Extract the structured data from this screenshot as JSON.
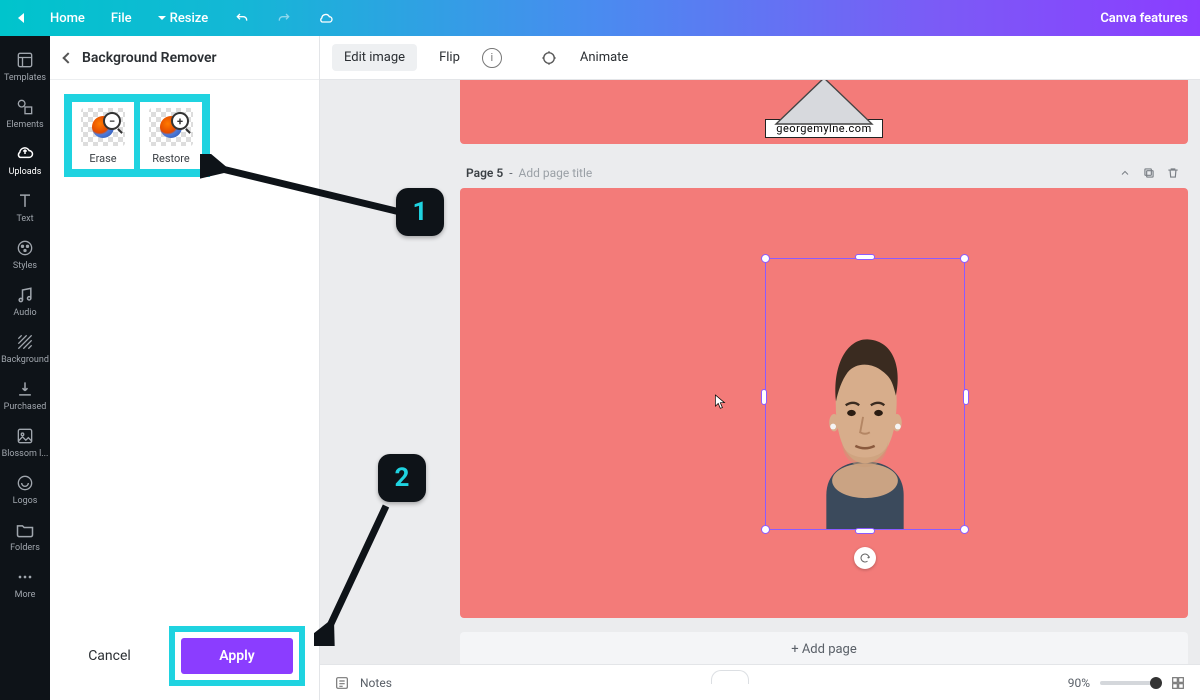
{
  "topbar": {
    "home": "Home",
    "file": "File",
    "resize": "Resize",
    "brand": "Canva features"
  },
  "rail": {
    "items": [
      {
        "label": "Templates"
      },
      {
        "label": "Elements"
      },
      {
        "label": "Uploads"
      },
      {
        "label": "Text"
      },
      {
        "label": "Styles"
      },
      {
        "label": "Audio"
      },
      {
        "label": "Background"
      },
      {
        "label": "Purchased"
      },
      {
        "label": "Blossom l..."
      },
      {
        "label": "Logos"
      },
      {
        "label": "Folders"
      },
      {
        "label": "More"
      }
    ]
  },
  "panel": {
    "title": "Background Remover",
    "tools": {
      "erase": "Erase",
      "restore": "Restore"
    },
    "cancel": "Cancel",
    "apply": "Apply"
  },
  "toolrow": {
    "edit": "Edit image",
    "flip": "Flip",
    "animate": "Animate"
  },
  "canvas": {
    "prev_url": "georgemylne.com",
    "page_label": "Page 5",
    "page_title_placeholder": "Add page title",
    "add_page": "+ Add page"
  },
  "bottombar": {
    "notes": "Notes",
    "zoom": "90%"
  },
  "annotations": {
    "one": "1",
    "two": "2"
  }
}
